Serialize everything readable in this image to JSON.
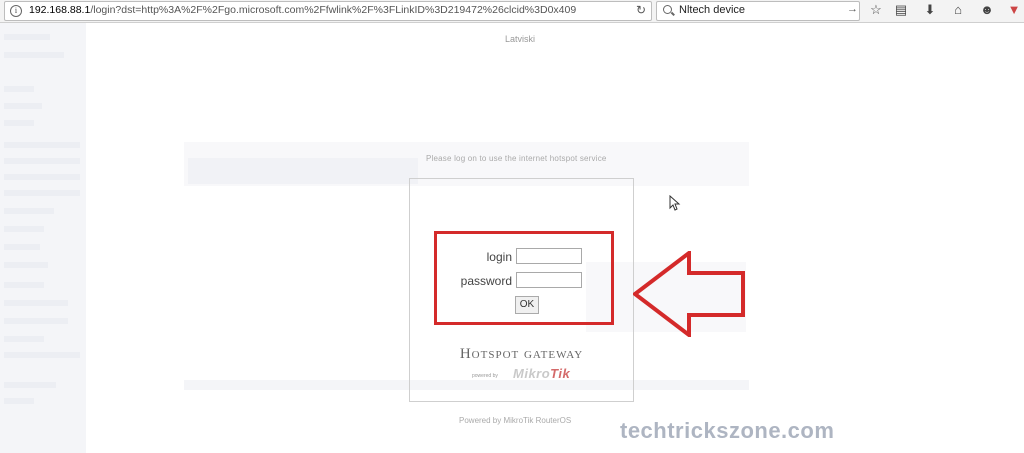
{
  "browser": {
    "url_host": "192.168.88.1",
    "url_path": "/login?dst=http%3A%2F%2Fgo.microsoft.com%2Ffwlink%2F%3FLinkID%3D219472%26clcid%3D0x409",
    "search_value": "Nltech device",
    "icons": [
      "info-icon",
      "reload-icon",
      "search-icon",
      "go-arrow-icon",
      "bookmark-star-icon",
      "reading-list-icon",
      "download-icon",
      "home-icon",
      "chat-icon",
      "pocket-icon"
    ]
  },
  "page": {
    "language_link": "Latviski",
    "instruction": "Please log on to use the internet hotspot service",
    "login_label": "login",
    "login_value": "",
    "password_label": "password",
    "password_value": "",
    "ok_label": "OK",
    "brand_prefix": "Hotspot gateway",
    "powered_small": "powered by",
    "mikrotik_a": "Mikro",
    "mikrotik_b": "Tik",
    "footer": "Powered by MikroTik RouterOS"
  },
  "overlay": {
    "watermark": "techtrickszone.com",
    "highlight_color": "#d42a2a"
  }
}
